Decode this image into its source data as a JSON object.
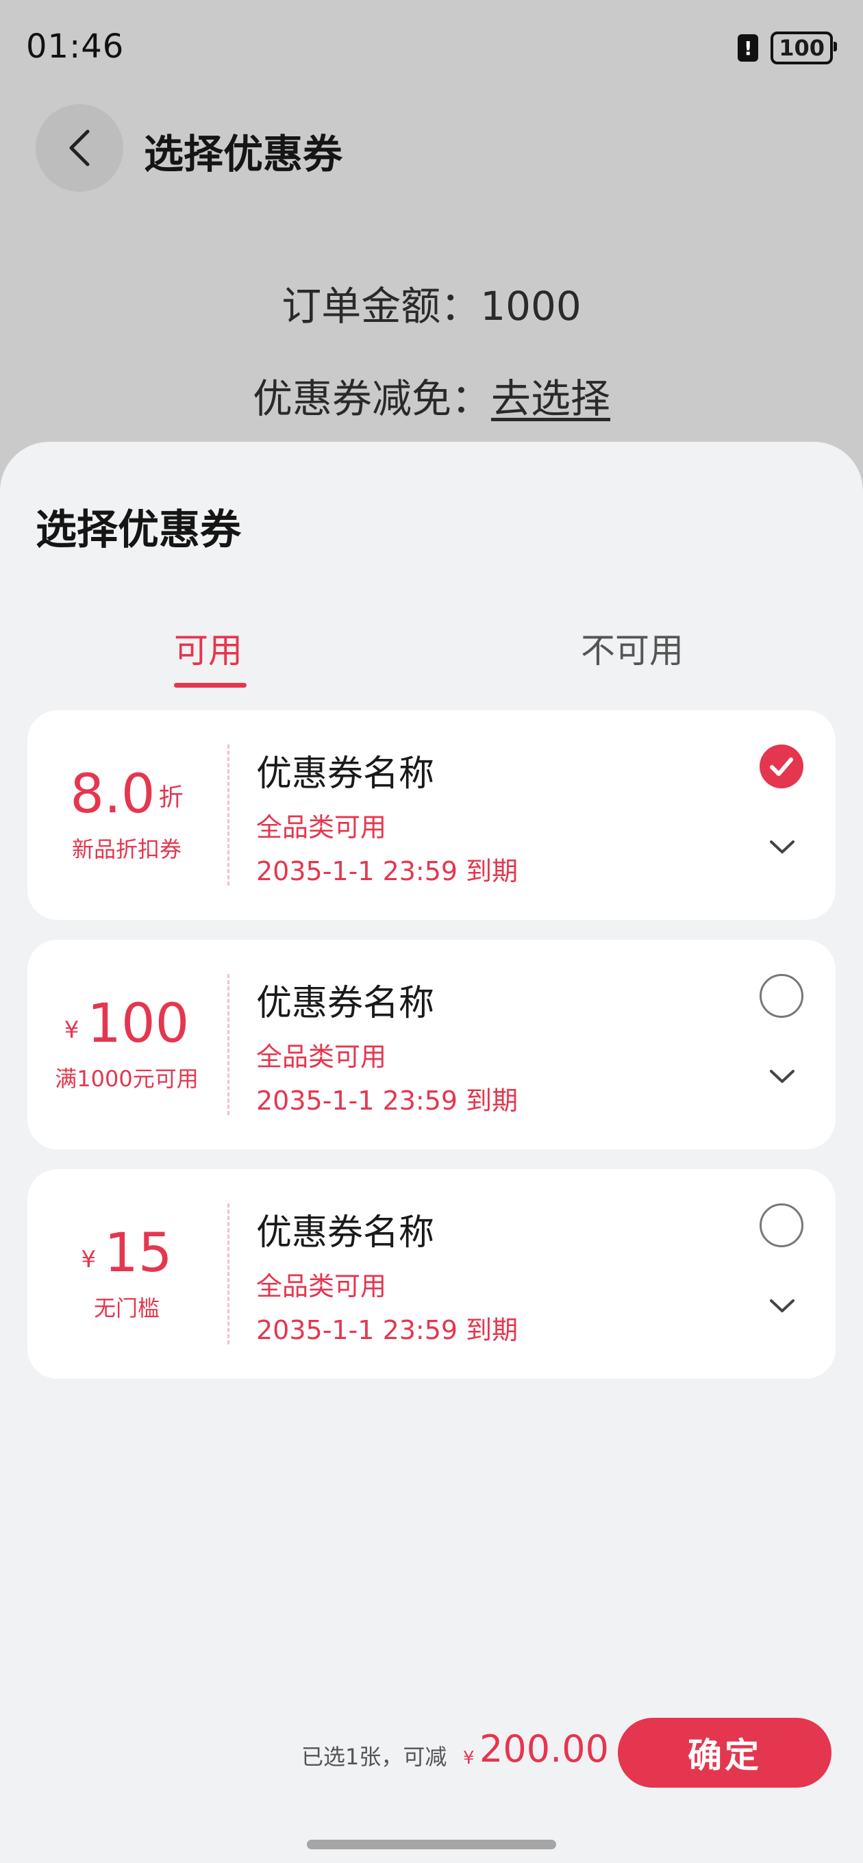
{
  "status_bar": {
    "time": "01:46",
    "alert_glyph": "!",
    "battery": "100"
  },
  "header": {
    "title": "选择优惠券"
  },
  "order": {
    "amount_label": "订单金额：",
    "amount_value": "1000",
    "coupon_label": "优惠券减免：",
    "coupon_link": "去选择"
  },
  "sheet": {
    "title": "选择优惠券",
    "tabs": [
      {
        "label": "可用",
        "active": true
      },
      {
        "label": "不可用",
        "active": false
      }
    ],
    "coupons": [
      {
        "value": "8.0",
        "value_suffix": "折",
        "value_prefix": "",
        "desc": "新品折扣券",
        "name": "优惠券名称",
        "scope": "全品类可用",
        "expiry": "2035-1-1 23:59 到期",
        "selected": true
      },
      {
        "value": "100",
        "value_suffix": "",
        "value_prefix": "¥",
        "desc": "满1000元可用",
        "name": "优惠券名称",
        "scope": "全品类可用",
        "expiry": "2035-1-1 23:59 到期",
        "selected": false
      },
      {
        "value": "15",
        "value_suffix": "",
        "value_prefix": "¥",
        "desc": "无门槛",
        "name": "优惠券名称",
        "scope": "全品类可用",
        "expiry": "2035-1-1 23:59 到期",
        "selected": false
      }
    ]
  },
  "footer": {
    "summary": "已选1张，可减",
    "currency": "¥",
    "amount": "200.00",
    "confirm_label": "确定"
  },
  "colors": {
    "accent": "#e5364f",
    "sheet_bg": "#f1f2f4",
    "overlay_bg": "#cacaca"
  },
  "icons": [
    "back-arrow-icon",
    "alert-icon",
    "battery-icon",
    "checkmark-icon",
    "chevron-down-icon"
  ]
}
